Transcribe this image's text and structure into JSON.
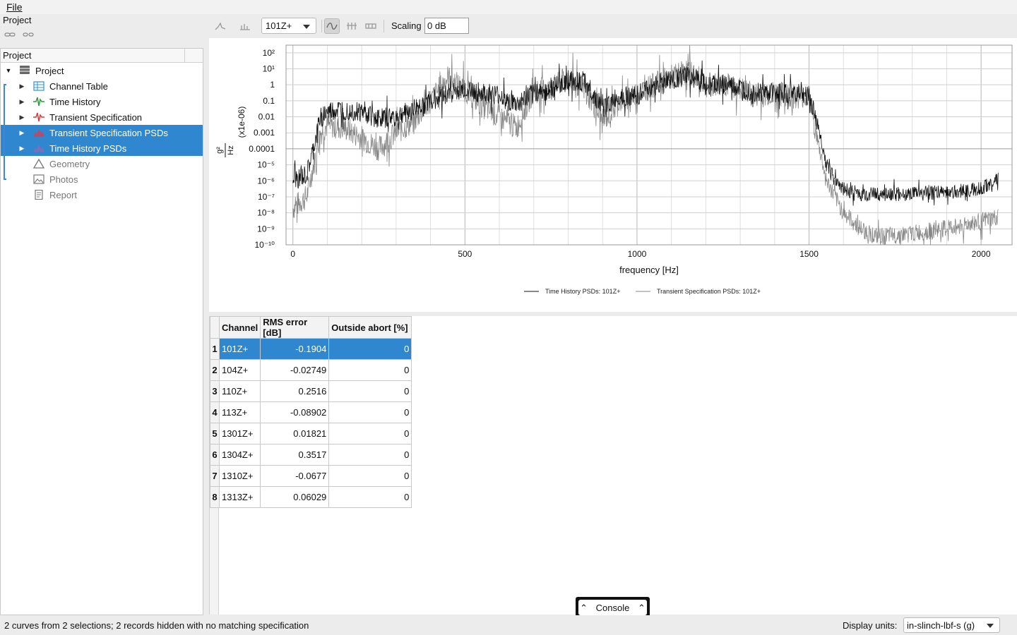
{
  "menu": {
    "file": "File"
  },
  "dock": {
    "title": "Project",
    "column_header": "Project"
  },
  "tree": {
    "root": "Project",
    "items": [
      {
        "label": "Channel Table",
        "icon": "table-icon",
        "selected": false,
        "disabled": false
      },
      {
        "label": "Time History",
        "icon": "time-history-icon",
        "selected": false,
        "disabled": false
      },
      {
        "label": "Transient Specification",
        "icon": "transient-spec-icon",
        "selected": false,
        "disabled": false
      },
      {
        "label": "Transient Specification PSDs",
        "icon": "transient-psd-icon",
        "selected": true,
        "disabled": false
      },
      {
        "label": "Time History PSDs",
        "icon": "time-history-psd-icon",
        "selected": true,
        "disabled": false
      },
      {
        "label": "Geometry",
        "icon": "geometry-icon",
        "selected": false,
        "disabled": true
      },
      {
        "label": "Photos",
        "icon": "photos-icon",
        "selected": false,
        "disabled": true
      },
      {
        "label": "Report",
        "icon": "report-icon",
        "selected": false,
        "disabled": true
      }
    ]
  },
  "toolbar": {
    "channel_value": "101Z+",
    "scaling_label": "Scaling",
    "scaling_value": "0 dB"
  },
  "chart_data": {
    "type": "line",
    "title": "",
    "xlabel": "frequency [Hz]",
    "ylabel_num": "g²",
    "ylabel_den": "Hz",
    "ylabel_scale": "(x1e-06)",
    "yscale": "log",
    "xlim": [
      -20,
      2090
    ],
    "ylim": [
      1e-10,
      300
    ],
    "x_ticks": [
      "0",
      "500",
      "1000",
      "1500",
      "2000"
    ],
    "x_tick_values": [
      0,
      500,
      1000,
      1500,
      2000
    ],
    "y_ticks": [
      "10²",
      "10¹",
      "1",
      "0.1",
      "0.01",
      "0.001",
      "0.0001",
      "10⁻⁵",
      "10⁻⁶",
      "10⁻⁷",
      "10⁻⁸",
      "10⁻⁹",
      "10⁻¹⁰"
    ],
    "y_tick_exponents": [
      2,
      1,
      0,
      -1,
      -2,
      -3,
      -4,
      -5,
      -6,
      -7,
      -8,
      -9,
      -10
    ],
    "grid": true,
    "legend_position": "bottom",
    "series": [
      {
        "name": "Time History PSDs: 101Z+",
        "color": "#111111",
        "x": [
          0,
          40,
          60,
          80,
          100,
          150,
          200,
          250,
          300,
          350,
          400,
          450,
          500,
          550,
          600,
          650,
          700,
          750,
          800,
          850,
          900,
          950,
          1000,
          1050,
          1100,
          1150,
          1200,
          1250,
          1300,
          1350,
          1400,
          1450,
          1500,
          1520,
          1550,
          1600,
          1650,
          1700,
          1800,
          1900,
          2000,
          2050
        ],
        "y": [
          1e-06,
          2e-06,
          0.0001,
          0.01,
          0.02,
          0.03,
          0.02,
          0.008,
          0.01,
          0.03,
          0.1,
          0.3,
          0.5,
          0.3,
          0.2,
          0.05,
          0.3,
          0.5,
          2,
          1.5,
          0.03,
          0.2,
          0.2,
          1,
          2,
          4,
          1,
          1,
          0.5,
          0.3,
          0.3,
          0.3,
          0.2,
          0.01,
          1e-05,
          3e-07,
          1.5e-07,
          1.5e-07,
          1.5e-07,
          2e-07,
          3e-07,
          1.5e-06
        ]
      },
      {
        "name": "Transient Specification PSDs: 101Z+",
        "color": "#878787",
        "x": [
          0,
          40,
          60,
          80,
          100,
          150,
          200,
          250,
          300,
          350,
          400,
          450,
          500,
          550,
          600,
          650,
          700,
          750,
          800,
          850,
          900,
          950,
          1000,
          1050,
          1100,
          1150,
          1200,
          1250,
          1300,
          1350,
          1400,
          1450,
          1500,
          1520,
          1550,
          1600,
          1650,
          1700,
          1800,
          1900,
          2000,
          2050
        ],
        "y": [
          2e-08,
          1e-07,
          1e-05,
          0.001,
          0.003,
          0.002,
          0.0005,
          0.0001,
          0.001,
          0.005,
          0.1,
          3,
          0.5,
          0.05,
          0.01,
          0.002,
          0.5,
          0.5,
          3,
          0.5,
          0.005,
          0.1,
          0.3,
          1,
          3,
          8,
          1,
          1,
          0.5,
          0.2,
          0.3,
          0.2,
          0.2,
          0.001,
          1e-06,
          1e-08,
          1e-09,
          3e-10,
          5e-10,
          1e-09,
          3e-09,
          5e-09
        ]
      }
    ]
  },
  "table": {
    "columns": [
      "Channel",
      "RMS error [dB]",
      "Outside abort [%]"
    ],
    "rows": [
      {
        "n": "1",
        "channel": "101Z+",
        "rms": "-0.1904",
        "abort": "0",
        "selected": true
      },
      {
        "n": "2",
        "channel": "104Z+",
        "rms": "-0.02749",
        "abort": "0",
        "selected": false
      },
      {
        "n": "3",
        "channel": "110Z+",
        "rms": "0.2516",
        "abort": "0",
        "selected": false
      },
      {
        "n": "4",
        "channel": "113Z+",
        "rms": "-0.08902",
        "abort": "0",
        "selected": false
      },
      {
        "n": "5",
        "channel": "1301Z+",
        "rms": "0.01821",
        "abort": "0",
        "selected": false
      },
      {
        "n": "6",
        "channel": "1304Z+",
        "rms": "0.3517",
        "abort": "0",
        "selected": false
      },
      {
        "n": "7",
        "channel": "1310Z+",
        "rms": "-0.0677",
        "abort": "0",
        "selected": false
      },
      {
        "n": "8",
        "channel": "1313Z+",
        "rms": "0.06029",
        "abort": "0",
        "selected": false
      }
    ]
  },
  "console": {
    "label": "Console"
  },
  "status": {
    "message": "2 curves from 2 selections; 2 records hidden with no matching specification",
    "units_label": "Display units:",
    "units_value": "in-slinch-lbf-s (g)"
  },
  "colors": {
    "selection": "#2f88cf",
    "accent": "#3f86d8"
  }
}
